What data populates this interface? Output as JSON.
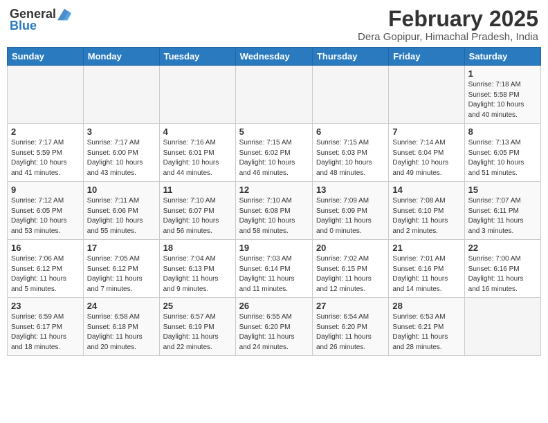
{
  "header": {
    "logo_general": "General",
    "logo_blue": "Blue",
    "month_title": "February 2025",
    "location": "Dera Gopipur, Himachal Pradesh, India"
  },
  "weekdays": [
    "Sunday",
    "Monday",
    "Tuesday",
    "Wednesday",
    "Thursday",
    "Friday",
    "Saturday"
  ],
  "weeks": [
    [
      {
        "day": "",
        "info": ""
      },
      {
        "day": "",
        "info": ""
      },
      {
        "day": "",
        "info": ""
      },
      {
        "day": "",
        "info": ""
      },
      {
        "day": "",
        "info": ""
      },
      {
        "day": "",
        "info": ""
      },
      {
        "day": "1",
        "info": "Sunrise: 7:18 AM\nSunset: 5:58 PM\nDaylight: 10 hours\nand 40 minutes."
      }
    ],
    [
      {
        "day": "2",
        "info": "Sunrise: 7:17 AM\nSunset: 5:59 PM\nDaylight: 10 hours\nand 41 minutes."
      },
      {
        "day": "3",
        "info": "Sunrise: 7:17 AM\nSunset: 6:00 PM\nDaylight: 10 hours\nand 43 minutes."
      },
      {
        "day": "4",
        "info": "Sunrise: 7:16 AM\nSunset: 6:01 PM\nDaylight: 10 hours\nand 44 minutes."
      },
      {
        "day": "5",
        "info": "Sunrise: 7:15 AM\nSunset: 6:02 PM\nDaylight: 10 hours\nand 46 minutes."
      },
      {
        "day": "6",
        "info": "Sunrise: 7:15 AM\nSunset: 6:03 PM\nDaylight: 10 hours\nand 48 minutes."
      },
      {
        "day": "7",
        "info": "Sunrise: 7:14 AM\nSunset: 6:04 PM\nDaylight: 10 hours\nand 49 minutes."
      },
      {
        "day": "8",
        "info": "Sunrise: 7:13 AM\nSunset: 6:05 PM\nDaylight: 10 hours\nand 51 minutes."
      }
    ],
    [
      {
        "day": "9",
        "info": "Sunrise: 7:12 AM\nSunset: 6:05 PM\nDaylight: 10 hours\nand 53 minutes."
      },
      {
        "day": "10",
        "info": "Sunrise: 7:11 AM\nSunset: 6:06 PM\nDaylight: 10 hours\nand 55 minutes."
      },
      {
        "day": "11",
        "info": "Sunrise: 7:10 AM\nSunset: 6:07 PM\nDaylight: 10 hours\nand 56 minutes."
      },
      {
        "day": "12",
        "info": "Sunrise: 7:10 AM\nSunset: 6:08 PM\nDaylight: 10 hours\nand 58 minutes."
      },
      {
        "day": "13",
        "info": "Sunrise: 7:09 AM\nSunset: 6:09 PM\nDaylight: 11 hours\nand 0 minutes."
      },
      {
        "day": "14",
        "info": "Sunrise: 7:08 AM\nSunset: 6:10 PM\nDaylight: 11 hours\nand 2 minutes."
      },
      {
        "day": "15",
        "info": "Sunrise: 7:07 AM\nSunset: 6:11 PM\nDaylight: 11 hours\nand 3 minutes."
      }
    ],
    [
      {
        "day": "16",
        "info": "Sunrise: 7:06 AM\nSunset: 6:12 PM\nDaylight: 11 hours\nand 5 minutes."
      },
      {
        "day": "17",
        "info": "Sunrise: 7:05 AM\nSunset: 6:12 PM\nDaylight: 11 hours\nand 7 minutes."
      },
      {
        "day": "18",
        "info": "Sunrise: 7:04 AM\nSunset: 6:13 PM\nDaylight: 11 hours\nand 9 minutes."
      },
      {
        "day": "19",
        "info": "Sunrise: 7:03 AM\nSunset: 6:14 PM\nDaylight: 11 hours\nand 11 minutes."
      },
      {
        "day": "20",
        "info": "Sunrise: 7:02 AM\nSunset: 6:15 PM\nDaylight: 11 hours\nand 12 minutes."
      },
      {
        "day": "21",
        "info": "Sunrise: 7:01 AM\nSunset: 6:16 PM\nDaylight: 11 hours\nand 14 minutes."
      },
      {
        "day": "22",
        "info": "Sunrise: 7:00 AM\nSunset: 6:16 PM\nDaylight: 11 hours\nand 16 minutes."
      }
    ],
    [
      {
        "day": "23",
        "info": "Sunrise: 6:59 AM\nSunset: 6:17 PM\nDaylight: 11 hours\nand 18 minutes."
      },
      {
        "day": "24",
        "info": "Sunrise: 6:58 AM\nSunset: 6:18 PM\nDaylight: 11 hours\nand 20 minutes."
      },
      {
        "day": "25",
        "info": "Sunrise: 6:57 AM\nSunset: 6:19 PM\nDaylight: 11 hours\nand 22 minutes."
      },
      {
        "day": "26",
        "info": "Sunrise: 6:55 AM\nSunset: 6:20 PM\nDaylight: 11 hours\nand 24 minutes."
      },
      {
        "day": "27",
        "info": "Sunrise: 6:54 AM\nSunset: 6:20 PM\nDaylight: 11 hours\nand 26 minutes."
      },
      {
        "day": "28",
        "info": "Sunrise: 6:53 AM\nSunset: 6:21 PM\nDaylight: 11 hours\nand 28 minutes."
      },
      {
        "day": "",
        "info": ""
      }
    ]
  ]
}
